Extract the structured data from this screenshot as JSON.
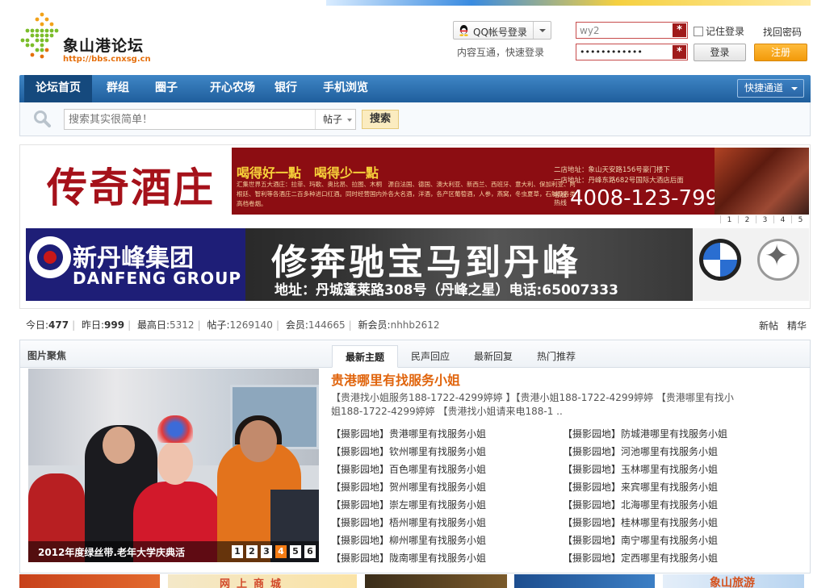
{
  "header": {
    "logo_title": "象山港论坛",
    "logo_url": "http://bbs.cnxsg.cn",
    "qq_login": "QQ帐号登录",
    "qq_sub": "内容互通，快速登录",
    "username_value": "wy2",
    "password_value": "••••••••••••",
    "required_mark": "*",
    "remember_label": "记住登录",
    "find_password": "找回密码",
    "login_button": "登录",
    "register_button": "注册"
  },
  "nav": {
    "items": [
      "论坛首页",
      "群组",
      "圈子",
      "开心农场",
      "银行",
      "手机浏览"
    ],
    "active_index": 0,
    "quick_channel": "快捷通道"
  },
  "search": {
    "placeholder": "搜索其实很简单！",
    "type": "帖子",
    "button": "搜索"
  },
  "ads": {
    "ad1": {
      "brand": "传奇酒庄",
      "slogan": "喝得好一點　喝得少一點",
      "desc": "汇集世界五大酒庄：拉菲、玛歌、奥比昂、拉图、木桐　源自法国、德国、澳大利亚、新西兰、西班牙、意大利、保加利亚、阿根廷、智利等各酒庄二百多种进口红酒。同时经营国内外各大名酒，洋酒，各产区葡萄酒，人参，燕窝，冬虫夏草，石斛及各类高档卷烟。",
      "address_2": "二店地址：象山天安路156号豪门楼下",
      "address_1": "一店地址：丹峰东路682号国际大酒店后面",
      "hotline_label": "客服热线",
      "phone": "4008-123-799",
      "pager": [
        "1",
        "2",
        "3",
        "4",
        "5"
      ]
    },
    "ad2": {
      "brand_cn": "新丹峰集团",
      "brand_en": "DANFENG GROUP",
      "headline": "修奔驰宝马到丹峰",
      "address": "地址：丹城蓬莱路308号（丹峰之星）电话:65007333"
    }
  },
  "stats": {
    "today_label": "今日:",
    "today": "477",
    "yesterday_label": "昨日:",
    "yesterday": "999",
    "max_label": "最高日:",
    "max": "5312",
    "posts_label": "帖子:",
    "posts": "1269140",
    "members_label": "会员:",
    "members": "144665",
    "newmember_label": "新会员:",
    "newmember": "nhhb2612",
    "new_post": "新帖",
    "digest": "精华"
  },
  "focus": {
    "title": "图片聚焦",
    "tabs": [
      "最新主题",
      "民声回应",
      "最新回复",
      "热门推荐"
    ],
    "active_tab": 0,
    "photo_caption": "2012年度绿丝带.老年大学庆典活",
    "photo_pager": [
      "1",
      "2",
      "3",
      "4",
      "5",
      "6"
    ],
    "photo_current": 4,
    "headline": "贵港哪里有找服务小姐",
    "summary": "【贵港找小姐服务188-1722-4299婷婷 】【贵港小姐188-1722-4299婷婷 【贵港哪里有找小姐188-1722-4299婷婷 【贵港找小姐请来电188-1 ..",
    "category": "【摄影园地】",
    "list_left": [
      "贵港哪里有找服务小姐",
      "钦州哪里有找服务小姐",
      "百色哪里有找服务小姐",
      "贺州哪里有找服务小姐",
      "崇左哪里有找服务小姐",
      "梧州哪里有找服务小姐",
      "柳州哪里有找服务小姐",
      "陇南哪里有找服务小姐"
    ],
    "list_right": [
      "防城港哪里有找服务小姐",
      "河池哪里有找服务小姐",
      "玉林哪里有找服务小姐",
      "来宾哪里有找服务小姐",
      "北海哪里有找服务小姐",
      "桂林哪里有找服务小姐",
      "南宁哪里有找服务小姐",
      "定西哪里有找服务小姐"
    ]
  },
  "teasers": {
    "t2": "网上商城",
    "t5": "象山旅游"
  },
  "colors": {
    "nav_blue": "#1f5e9c",
    "accent_orange": "#f29a0a",
    "headline_orange": "#e0640c",
    "ad1_red": "#8c0d12"
  }
}
